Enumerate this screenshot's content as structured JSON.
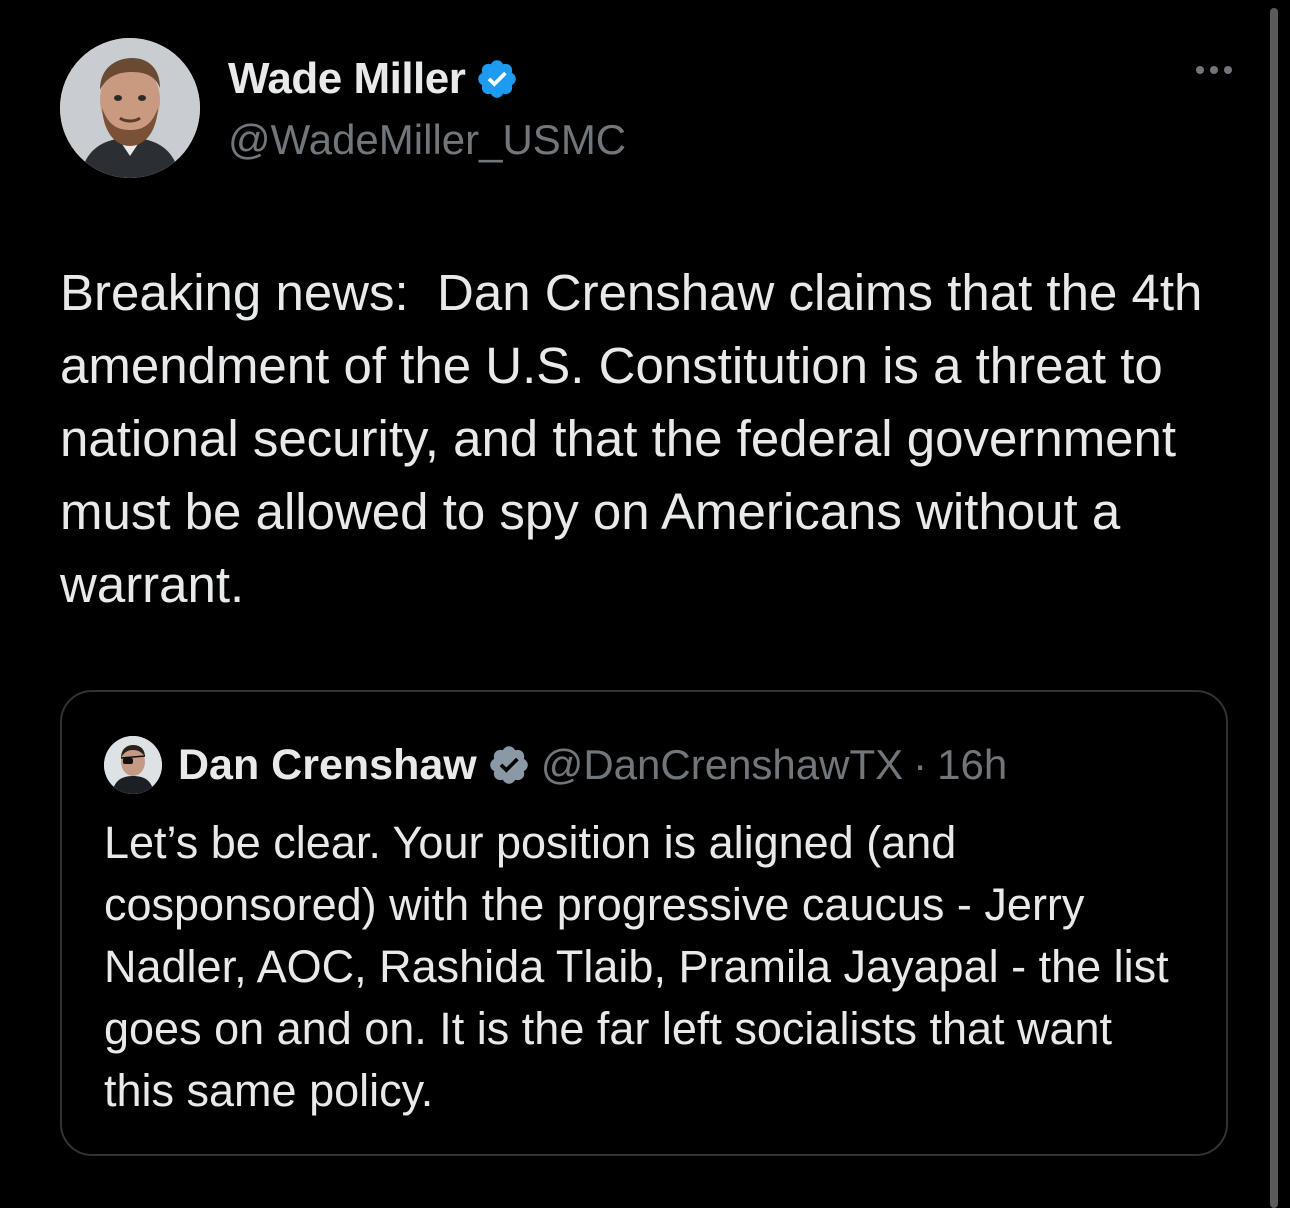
{
  "colors": {
    "background": "#000000",
    "primary_text": "#e7e9ea",
    "secondary_text": "#71767b",
    "verified_badge": "#1d9bf0",
    "quote_border": "#2f3336"
  },
  "author": {
    "display_name": "Wade Miller",
    "handle": "@WadeMiller_USMC",
    "verified": true,
    "avatar_icon": "avatar-portrait",
    "more_icon": "more-options-icon"
  },
  "tweet": {
    "text": "Breaking news:  Dan Crenshaw claims that the 4th amendment of the U.S. Constitution is a threat to national security, and that the federal government must be allowed to spy on Americans without a warrant."
  },
  "quoted_tweet": {
    "display_name": "Dan Crenshaw",
    "handle": "@DanCrenshawTX",
    "separator": "·",
    "time": "16h",
    "verified": true,
    "text": "Let’s be clear. Your position is aligned (and cosponsored) with the progressive caucus - Jerry Nadler, AOC, Rashida Tlaib, Pramila Jayapal - the list goes on and on. It is the far left socialists that want this same policy."
  }
}
